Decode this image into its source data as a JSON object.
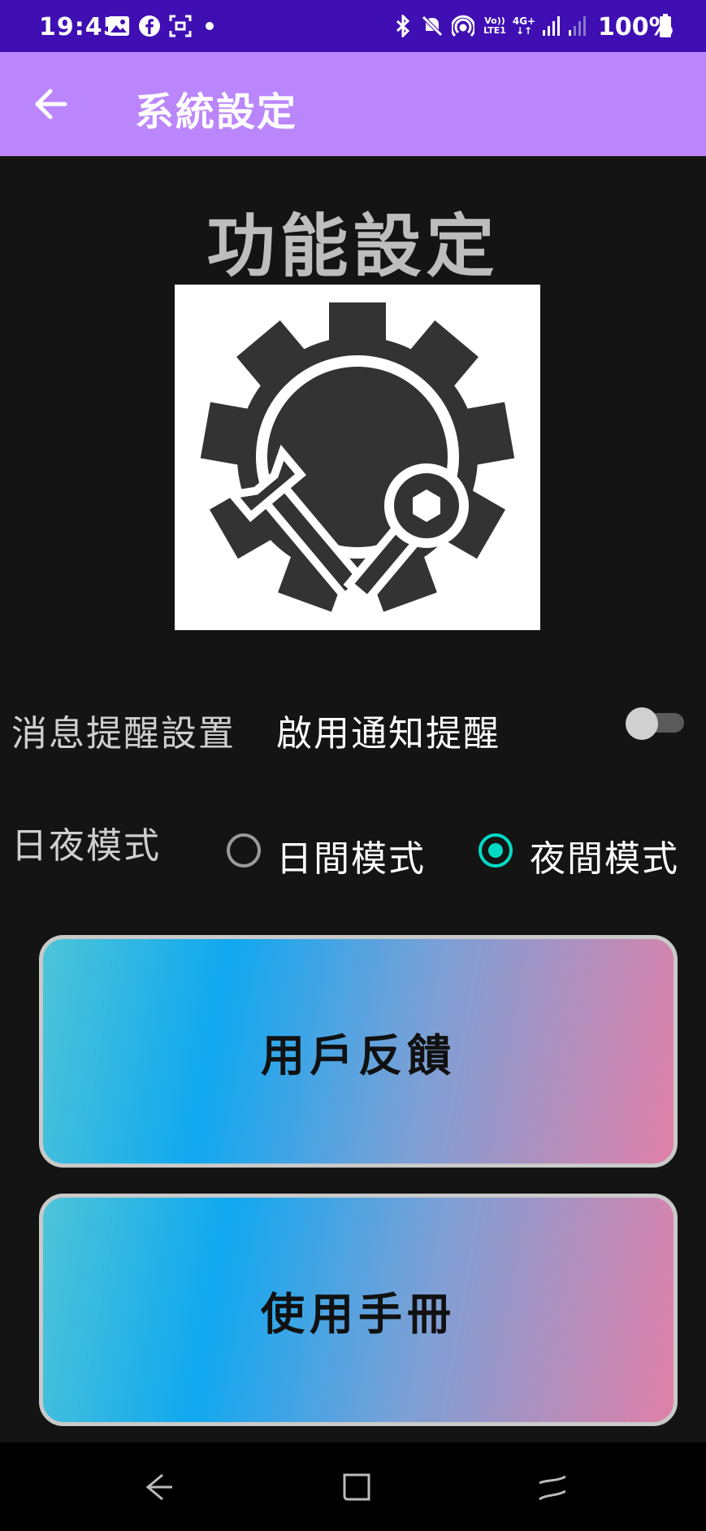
{
  "status_bar": {
    "time": "19:45",
    "left_icons": [
      "image-icon",
      "facebook-icon",
      "scan-icon",
      "dot-icon"
    ],
    "right_icons": [
      "bluetooth-icon",
      "mute-icon",
      "hotspot-icon",
      "volte-icon",
      "4g-icon",
      "signal-icon",
      "signal-weak-icon",
      "battery-icon"
    ],
    "volte_label_1": "Vo))",
    "volte_label_2": "LTE1",
    "network_label": "4G+",
    "battery": "100%"
  },
  "app_bar": {
    "back_icon": "arrow-left-icon",
    "title": "系統設定",
    "background": "#bb86fc"
  },
  "section_title": "功能設定",
  "settings_image": {
    "icon": "gear-wrench-icon"
  },
  "notification_row": {
    "label": "消息提醒設置",
    "value": "啟用通知提醒",
    "switch_on": false
  },
  "theme_row": {
    "label": "日夜模式",
    "options": [
      {
        "label": "日間模式",
        "selected": false
      },
      {
        "label": "夜間模式",
        "selected": true
      }
    ],
    "accent": "#03dac5"
  },
  "buttons": {
    "feedback": "用戶反饋",
    "manual": "使用手冊"
  },
  "nav_bar": {
    "icons": [
      "back-nav-icon",
      "home-nav-icon",
      "recents-nav-icon"
    ]
  }
}
